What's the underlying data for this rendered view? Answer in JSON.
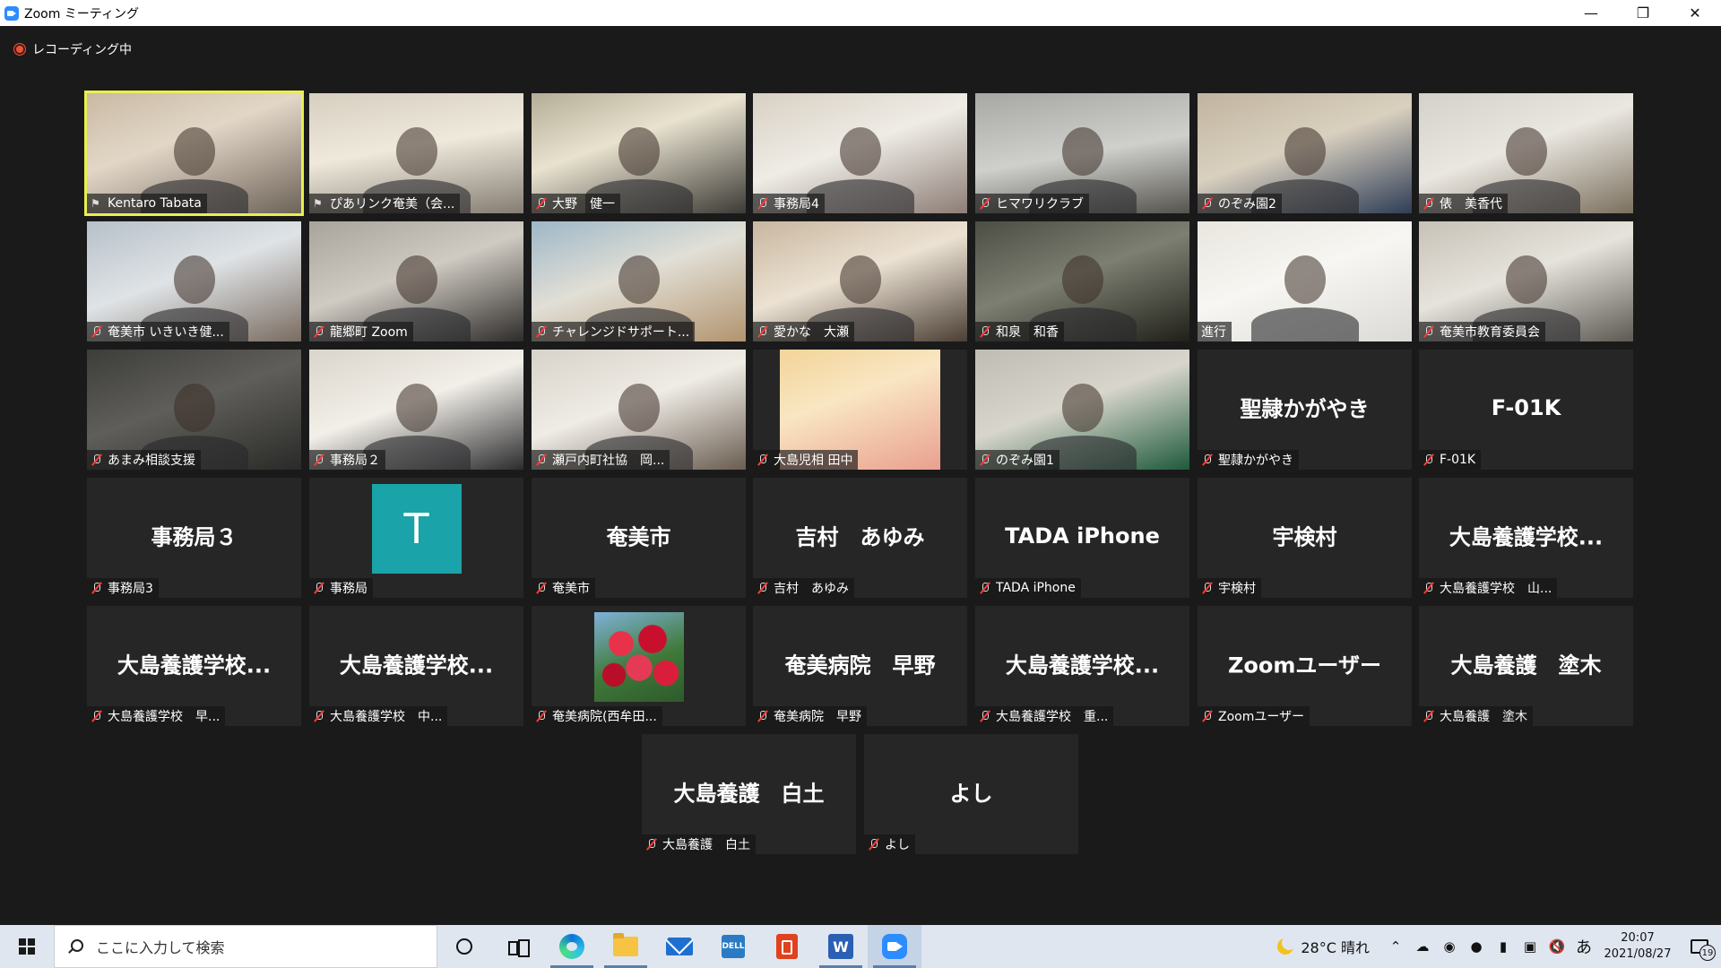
{
  "window": {
    "title": "Zoom ミーティング",
    "minimize": "—",
    "restore": "❐",
    "close": "✕"
  },
  "recording": {
    "label": "レコーディング中"
  },
  "participants": [
    {
      "label": "Kentaro Tabata",
      "kind": "video",
      "icon": "pin",
      "active": true
    },
    {
      "label": "ぴあリンク奄美（会...",
      "kind": "video",
      "icon": "pin"
    },
    {
      "label": "大野　健一",
      "kind": "video",
      "icon": "mic-muted"
    },
    {
      "label": "事務局4",
      "kind": "video",
      "icon": "mic-muted"
    },
    {
      "label": "ヒマワリクラブ",
      "kind": "video",
      "icon": "mic-muted"
    },
    {
      "label": "のぞみ園2",
      "kind": "video",
      "icon": "mic-muted"
    },
    {
      "label": "俵　美香代",
      "kind": "video",
      "icon": "mic-muted"
    },
    {
      "label": "奄美市 いきいき健...",
      "kind": "video",
      "icon": "mic-muted"
    },
    {
      "label": "龍郷町 Zoom",
      "kind": "video",
      "icon": "mic-muted"
    },
    {
      "label": "チャレンジドサポート...",
      "kind": "video",
      "icon": "mic-muted"
    },
    {
      "label": "愛かな　大瀬",
      "kind": "video",
      "icon": "mic-muted"
    },
    {
      "label": "和泉　和香",
      "kind": "video",
      "icon": "mic-muted"
    },
    {
      "label": "進行",
      "kind": "video",
      "icon": "none"
    },
    {
      "label": "奄美市教育委員会",
      "kind": "video",
      "icon": "mic-muted"
    },
    {
      "label": "あまみ相談支援",
      "kind": "video",
      "icon": "mic-muted"
    },
    {
      "label": "事務局２",
      "kind": "video",
      "icon": "mic-muted"
    },
    {
      "label": "瀬戸内町社協　岡...",
      "kind": "video",
      "icon": "mic-muted"
    },
    {
      "label": "大島児相 田中",
      "kind": "video-small",
      "icon": "mic-muted"
    },
    {
      "label": "のぞみ園1",
      "kind": "video",
      "icon": "mic-muted"
    },
    {
      "label": "聖隷かがやき",
      "kind": "name",
      "big": "聖隷かがやき",
      "icon": "mic-muted"
    },
    {
      "label": "F-01K",
      "kind": "name",
      "big": "F-01K",
      "icon": "mic-muted"
    },
    {
      "label": "事務局3",
      "kind": "name",
      "big": "事務局３",
      "icon": "mic-muted"
    },
    {
      "label": "事務局",
      "kind": "avatar",
      "letter": "T",
      "icon": "mic-muted"
    },
    {
      "label": "奄美市",
      "kind": "name",
      "big": "奄美市",
      "icon": "mic-muted"
    },
    {
      "label": "吉村　あゆみ",
      "kind": "name",
      "big": "吉村　あゆみ",
      "icon": "mic-muted"
    },
    {
      "label": "TADA  iPhone",
      "kind": "name",
      "big": "TADA  iPhone",
      "icon": "mic-muted"
    },
    {
      "label": "宇検村",
      "kind": "name",
      "big": "宇検村",
      "icon": "mic-muted"
    },
    {
      "label": "大島養護学校　山...",
      "kind": "name",
      "big": "大島養護学校...",
      "icon": "mic-muted"
    },
    {
      "label": "大島養護学校　早...",
      "kind": "name",
      "big": "大島養護学校...",
      "icon": "mic-muted"
    },
    {
      "label": "大島養護学校　中...",
      "kind": "name",
      "big": "大島養護学校...",
      "icon": "mic-muted"
    },
    {
      "label": "奄美病院(西牟田...",
      "kind": "avatar-img",
      "icon": "mic-muted"
    },
    {
      "label": "奄美病院　早野",
      "kind": "name",
      "big": "奄美病院　早野",
      "icon": "mic-muted"
    },
    {
      "label": "大島養護学校　重...",
      "kind": "name",
      "big": "大島養護学校...",
      "icon": "mic-muted"
    },
    {
      "label": "Zoomユーザー",
      "kind": "name",
      "big": "Zoomユーザー",
      "icon": "mic-muted"
    },
    {
      "label": "大島養護　塗木",
      "kind": "name",
      "big": "大島養護　塗木",
      "icon": "mic-muted"
    },
    {
      "label": "大島養護　白土",
      "kind": "name",
      "big": "大島養護　白土",
      "icon": "mic-muted"
    },
    {
      "label": "よし",
      "kind": "name",
      "big": "よし",
      "icon": "mic-muted"
    }
  ],
  "colors": {
    "avatar_teal": "#1aa3a8",
    "active_outline": "#e8ef4f",
    "tile_bg": "#262626"
  },
  "taskbar": {
    "search_placeholder": "ここに入力して検索",
    "weather": "28°C  晴れ",
    "ime": "あ",
    "time": "20:07",
    "date": "2021/08/27",
    "notifications": "19",
    "dell_label": "DELL",
    "word_label": "W"
  }
}
